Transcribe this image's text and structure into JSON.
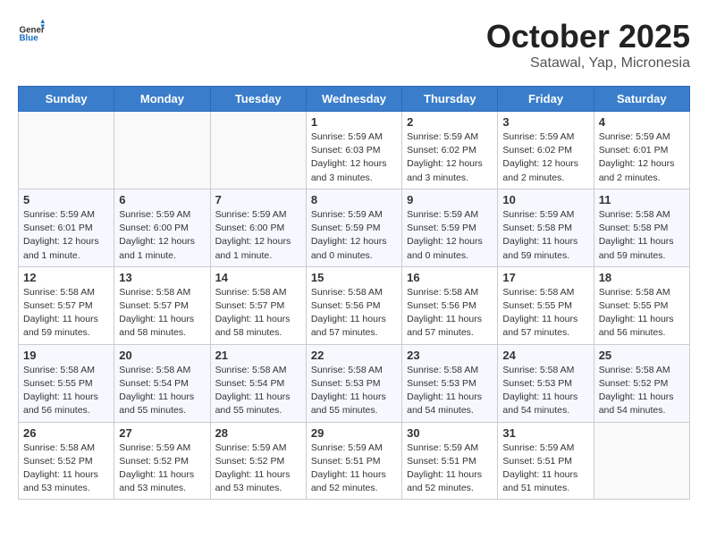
{
  "header": {
    "logo_general": "General",
    "logo_blue": "Blue",
    "month": "October 2025",
    "location": "Satawal, Yap, Micronesia"
  },
  "weekdays": [
    "Sunday",
    "Monday",
    "Tuesday",
    "Wednesday",
    "Thursday",
    "Friday",
    "Saturday"
  ],
  "weeks": [
    [
      {
        "day": "",
        "info": ""
      },
      {
        "day": "",
        "info": ""
      },
      {
        "day": "",
        "info": ""
      },
      {
        "day": "1",
        "info": "Sunrise: 5:59 AM\nSunset: 6:03 PM\nDaylight: 12 hours\nand 3 minutes."
      },
      {
        "day": "2",
        "info": "Sunrise: 5:59 AM\nSunset: 6:02 PM\nDaylight: 12 hours\nand 3 minutes."
      },
      {
        "day": "3",
        "info": "Sunrise: 5:59 AM\nSunset: 6:02 PM\nDaylight: 12 hours\nand 2 minutes."
      },
      {
        "day": "4",
        "info": "Sunrise: 5:59 AM\nSunset: 6:01 PM\nDaylight: 12 hours\nand 2 minutes."
      }
    ],
    [
      {
        "day": "5",
        "info": "Sunrise: 5:59 AM\nSunset: 6:01 PM\nDaylight: 12 hours\nand 1 minute."
      },
      {
        "day": "6",
        "info": "Sunrise: 5:59 AM\nSunset: 6:00 PM\nDaylight: 12 hours\nand 1 minute."
      },
      {
        "day": "7",
        "info": "Sunrise: 5:59 AM\nSunset: 6:00 PM\nDaylight: 12 hours\nand 1 minute."
      },
      {
        "day": "8",
        "info": "Sunrise: 5:59 AM\nSunset: 5:59 PM\nDaylight: 12 hours\nand 0 minutes."
      },
      {
        "day": "9",
        "info": "Sunrise: 5:59 AM\nSunset: 5:59 PM\nDaylight: 12 hours\nand 0 minutes."
      },
      {
        "day": "10",
        "info": "Sunrise: 5:59 AM\nSunset: 5:58 PM\nDaylight: 11 hours\nand 59 minutes."
      },
      {
        "day": "11",
        "info": "Sunrise: 5:58 AM\nSunset: 5:58 PM\nDaylight: 11 hours\nand 59 minutes."
      }
    ],
    [
      {
        "day": "12",
        "info": "Sunrise: 5:58 AM\nSunset: 5:57 PM\nDaylight: 11 hours\nand 59 minutes."
      },
      {
        "day": "13",
        "info": "Sunrise: 5:58 AM\nSunset: 5:57 PM\nDaylight: 11 hours\nand 58 minutes."
      },
      {
        "day": "14",
        "info": "Sunrise: 5:58 AM\nSunset: 5:57 PM\nDaylight: 11 hours\nand 58 minutes."
      },
      {
        "day": "15",
        "info": "Sunrise: 5:58 AM\nSunset: 5:56 PM\nDaylight: 11 hours\nand 57 minutes."
      },
      {
        "day": "16",
        "info": "Sunrise: 5:58 AM\nSunset: 5:56 PM\nDaylight: 11 hours\nand 57 minutes."
      },
      {
        "day": "17",
        "info": "Sunrise: 5:58 AM\nSunset: 5:55 PM\nDaylight: 11 hours\nand 57 minutes."
      },
      {
        "day": "18",
        "info": "Sunrise: 5:58 AM\nSunset: 5:55 PM\nDaylight: 11 hours\nand 56 minutes."
      }
    ],
    [
      {
        "day": "19",
        "info": "Sunrise: 5:58 AM\nSunset: 5:55 PM\nDaylight: 11 hours\nand 56 minutes."
      },
      {
        "day": "20",
        "info": "Sunrise: 5:58 AM\nSunset: 5:54 PM\nDaylight: 11 hours\nand 55 minutes."
      },
      {
        "day": "21",
        "info": "Sunrise: 5:58 AM\nSunset: 5:54 PM\nDaylight: 11 hours\nand 55 minutes."
      },
      {
        "day": "22",
        "info": "Sunrise: 5:58 AM\nSunset: 5:53 PM\nDaylight: 11 hours\nand 55 minutes."
      },
      {
        "day": "23",
        "info": "Sunrise: 5:58 AM\nSunset: 5:53 PM\nDaylight: 11 hours\nand 54 minutes."
      },
      {
        "day": "24",
        "info": "Sunrise: 5:58 AM\nSunset: 5:53 PM\nDaylight: 11 hours\nand 54 minutes."
      },
      {
        "day": "25",
        "info": "Sunrise: 5:58 AM\nSunset: 5:52 PM\nDaylight: 11 hours\nand 54 minutes."
      }
    ],
    [
      {
        "day": "26",
        "info": "Sunrise: 5:58 AM\nSunset: 5:52 PM\nDaylight: 11 hours\nand 53 minutes."
      },
      {
        "day": "27",
        "info": "Sunrise: 5:59 AM\nSunset: 5:52 PM\nDaylight: 11 hours\nand 53 minutes."
      },
      {
        "day": "28",
        "info": "Sunrise: 5:59 AM\nSunset: 5:52 PM\nDaylight: 11 hours\nand 53 minutes."
      },
      {
        "day": "29",
        "info": "Sunrise: 5:59 AM\nSunset: 5:51 PM\nDaylight: 11 hours\nand 52 minutes."
      },
      {
        "day": "30",
        "info": "Sunrise: 5:59 AM\nSunset: 5:51 PM\nDaylight: 11 hours\nand 52 minutes."
      },
      {
        "day": "31",
        "info": "Sunrise: 5:59 AM\nSunset: 5:51 PM\nDaylight: 11 hours\nand 51 minutes."
      },
      {
        "day": "",
        "info": ""
      }
    ]
  ]
}
